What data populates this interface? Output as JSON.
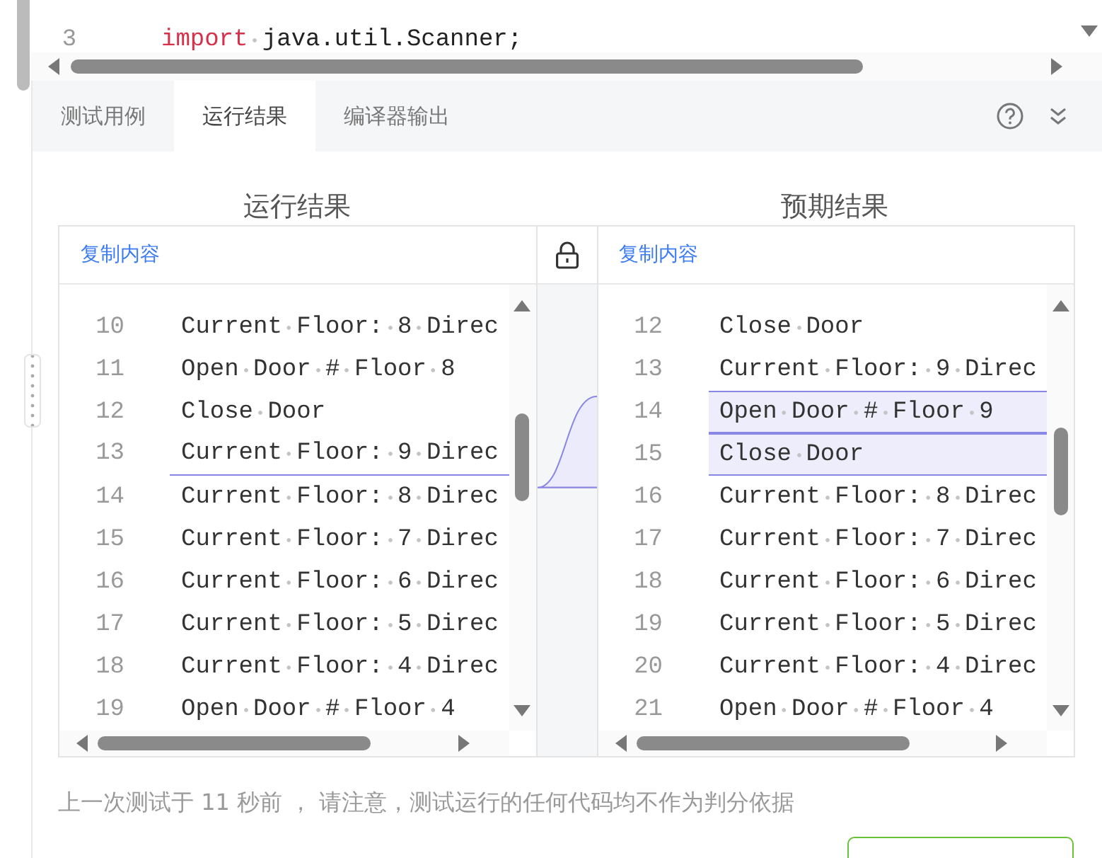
{
  "editor": {
    "lines": [
      {
        "number": "3",
        "tokens": [
          {
            "kind": "keyword",
            "text": "import"
          },
          {
            "kind": "plain",
            "text": " java.util.Scanner;"
          }
        ]
      }
    ]
  },
  "tabs": [
    {
      "label": "测试用例",
      "selected": false
    },
    {
      "label": "运行结果",
      "selected": true
    },
    {
      "label": "编译器输出",
      "selected": false
    }
  ],
  "compare": {
    "panes": [
      {
        "title": "运行结果",
        "copy": "复制内容",
        "lines": [
          {
            "number": "10",
            "text": "Current Floor: 8 Direc",
            "kind": "plain"
          },
          {
            "number": "11",
            "text": "Open Door # Floor 8",
            "kind": "plain"
          },
          {
            "number": "12",
            "text": "Close Door",
            "kind": "plain"
          },
          {
            "number": "13",
            "text": "Current Floor: 9 Direc",
            "kind": "gap-below"
          },
          {
            "number": "14",
            "text": "Current Floor: 8 Direc",
            "kind": "plain"
          },
          {
            "number": "15",
            "text": "Current Floor: 7 Direc",
            "kind": "plain"
          },
          {
            "number": "16",
            "text": "Current Floor: 6 Direc",
            "kind": "plain"
          },
          {
            "number": "17",
            "text": "Current Floor: 5 Direc",
            "kind": "plain"
          },
          {
            "number": "18",
            "text": "Current Floor: 4 Direc",
            "kind": "plain"
          },
          {
            "number": "19",
            "text": "Open Door # Floor 4",
            "kind": "plain"
          }
        ]
      },
      {
        "title": "预期结果",
        "copy": "复制内容",
        "lines": [
          {
            "number": "12",
            "text": "Close Door",
            "kind": "plain"
          },
          {
            "number": "13",
            "text": "Current Floor: 9 Direc",
            "kind": "plain"
          },
          {
            "number": "14",
            "text": "Open Door # Floor 9",
            "kind": "added"
          },
          {
            "number": "15",
            "text": "Close Door",
            "kind": "added"
          },
          {
            "number": "16",
            "text": "Current Floor: 8 Direc",
            "kind": "plain"
          },
          {
            "number": "17",
            "text": "Current Floor: 7 Direc",
            "kind": "plain"
          },
          {
            "number": "18",
            "text": "Current Floor: 6 Direc",
            "kind": "plain"
          },
          {
            "number": "19",
            "text": "Current Floor: 5 Direc",
            "kind": "plain"
          },
          {
            "number": "20",
            "text": "Current Floor: 4 Direc",
            "kind": "plain"
          },
          {
            "number": "21",
            "text": "Open Door # Floor 4",
            "kind": "plain"
          }
        ]
      }
    ]
  },
  "footer": {
    "note": "上一次测试于 11 秒前 ， 请注意，测试运行的任何代码均不作为判分依据"
  }
}
